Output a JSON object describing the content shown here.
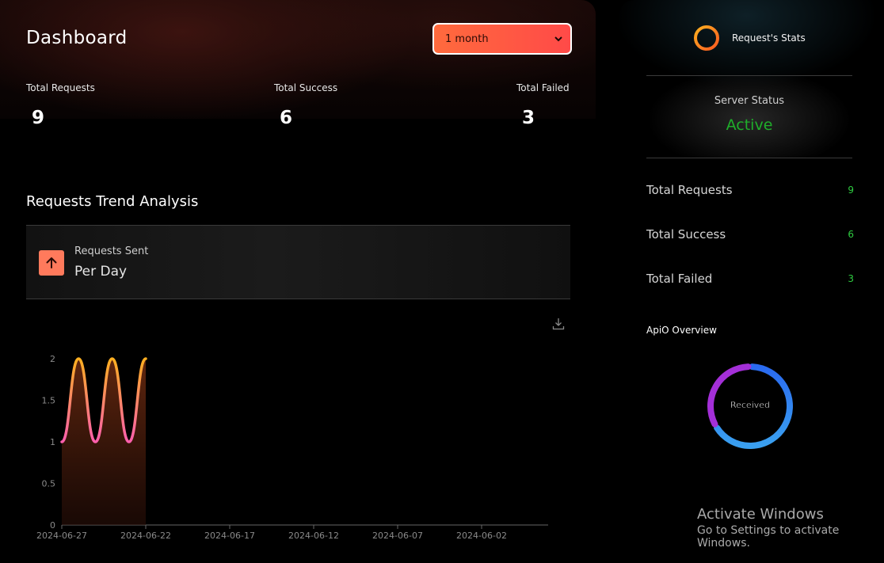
{
  "header": {
    "title": "Dashboard",
    "range_select": {
      "value": "1 month"
    }
  },
  "stats": {
    "total_requests": {
      "label": "Total Requests",
      "value": "9"
    },
    "total_success": {
      "label": "Total Success",
      "value": "6"
    },
    "total_failed": {
      "label": "Total Failed",
      "value": "3"
    }
  },
  "trend": {
    "title": "Requests Trend Analysis",
    "card_label": "Requests Sent",
    "card_sub": "Per Day"
  },
  "chart_data": {
    "type": "area",
    "x_ticks": [
      "2024-06-27",
      "2024-06-22",
      "2024-06-17",
      "2024-06-12",
      "2024-06-07",
      "2024-06-02"
    ],
    "y_ticks": [
      "0",
      "0.5",
      "1",
      "1.5",
      "2"
    ],
    "ylim": [
      0,
      2
    ],
    "x": [
      "2024-06-27",
      "2024-06-26",
      "2024-06-25",
      "2024-06-24",
      "2024-06-23",
      "2024-06-22"
    ],
    "values": [
      1,
      2,
      1,
      2,
      1,
      2
    ],
    "colors": {
      "top": "#ffb020",
      "bottom": "#ff5fae"
    },
    "grid": false
  },
  "side": {
    "header_label": "Request's Stats",
    "server_status_label": "Server Status",
    "server_status_value": "Active",
    "rows": [
      {
        "label": "Total Requests",
        "value": "9"
      },
      {
        "label": "Total Success",
        "value": "6"
      },
      {
        "label": "Total Failed",
        "value": "3"
      }
    ],
    "overview_title": "ApiO Overview",
    "donut_label": "Received",
    "donut": {
      "success": 6,
      "failed": 3
    }
  },
  "watermark": {
    "line1": "Activate Windows",
    "line2": "Go to Settings to activate Windows."
  }
}
